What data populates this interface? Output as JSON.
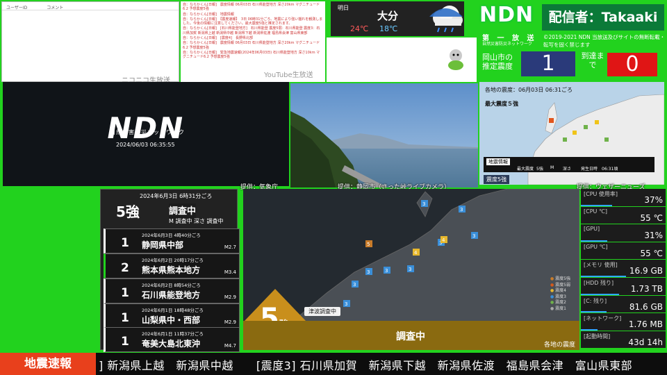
{
  "comments": {
    "col_user": "ユーザーID",
    "col_comment": "コメント",
    "service_label": "ニコニコ生放送"
  },
  "log": {
    "lines": [
      "自：ならかくん[日報]　震度情報 06月03日 石川県能登地方 深さ20km マグニチュード6.2 予想震度5強",
      "自：ならかくん[日報]　地震情報",
      "自：ならかくん[日報]　【震度速報】　3日 06時31分ごろ、地震により強い揺れを観測しました。今後の情報に注意してください。最大震度5強と推定されます。",
      "自：ならかくん[日報]　[石川県能登地方]　石川県能登 震度5弱：石川県能登 震度3：石川県加賀 新潟県上越 新潟県中越 新潟県下越 新潟県佐渡 福島県会津 富山県東部",
      "自：ならかくん[日報]　[震度4]　長野県北部",
      "自：ならかくん[日報]　震度情報 06月03日 石川県能登地方 深さ20km マグニチュード6.2 予想震度5強",
      "自：ならかくん[日報]　緊急地震速報(2024年06月03日) 石川県能登地方 深さ10km マグニチュード6.2 予想震度5強"
    ],
    "service_label": "YouTube生放送"
  },
  "weather": {
    "day": "明日",
    "city": "大分",
    "high": "24℃",
    "low": "18℃",
    "icon": "cloud-rain-icon"
  },
  "ndn": {
    "logo": "NDN",
    "caster": "配信者：Takaaki",
    "sub1": "第 一 放 送",
    "sub2": "自然災害防災ネットワーク",
    "copyright": "©2019-2021 NDN 当放送及びサイトの無断転載・転写を固く禁じます",
    "estimate_label": "岡山市の推定震度",
    "estimate_value": "1",
    "arrival_label": "到達まで",
    "arrival_value": "0"
  },
  "nico_video": {
    "logo": "NDN",
    "subtitle": "自然災害防災ネットワーク",
    "datetime": "2024/06/03 06:35:55"
  },
  "credits": {
    "jma": "提供：気象庁",
    "camera": "提供：静岡市（さった峠ライブカメラ）",
    "weathernews": "提供：ウェザーニューズ"
  },
  "shindo_map": {
    "title": "各地の震度：06月03日 06:31ごろ",
    "max": "最大震度５強",
    "info_label": "地震情報",
    "info_max": "最大震度",
    "info_max_val": "5強",
    "info_m": "M",
    "info_depth": "深さ",
    "info_time": "発生日時",
    "info_time_val": "06:31頃",
    "footer": "震度5強"
  },
  "latest_quake": {
    "date": "2024年6月3日 6時31分ごろ",
    "intensity": "5強",
    "status": "調査中",
    "meta": "M 調査中 深さ 調査中"
  },
  "history": [
    {
      "date": "2024年6月3日 4時40分ごろ",
      "intensity": "1",
      "place": "静岡県中部",
      "mag": "M2.7",
      "color": "#ffffff"
    },
    {
      "date": "2024年6月2日 20時17分ごろ",
      "intensity": "2",
      "place": "熊本県熊本地方",
      "mag": "M3.4",
      "color": "#22d21e"
    },
    {
      "date": "2024年6月2日 8時54分ごろ",
      "intensity": "1",
      "place": "石川県能登地方",
      "mag": "M2.9",
      "color": "#ffffff"
    },
    {
      "date": "2024年6月1日 18時48分ごろ",
      "intensity": "1",
      "place": "山梨県中・西部",
      "mag": "M2.9",
      "color": "#ffffff"
    },
    {
      "date": "2024年6月1日 11時37分ごろ",
      "intensity": "1",
      "place": "奄美大島北東沖",
      "mag": "M4.7",
      "color": "#ffffff"
    }
  ],
  "main_map": {
    "intensity": "5",
    "intensity_suffix": "強",
    "tsunami": "津波調査中",
    "status": "調査中",
    "caption": "各地の震度",
    "legend": [
      "震度5強",
      "震度5弱",
      "震度4",
      "震度3",
      "震度2",
      "震度1"
    ]
  },
  "stats": [
    {
      "label": "[CPU 使用率]",
      "value": "37%",
      "bar": 0.37
    },
    {
      "label": "[CPU ℃]",
      "value": "55 ℃",
      "bar": 0
    },
    {
      "label": "[GPU]",
      "value": "31%",
      "bar": 0.31
    },
    {
      "label": "[GPU ℃]",
      "value": "55 ℃",
      "bar": 0
    },
    {
      "label": "[メモリ 使用]",
      "value": "16.9 GB",
      "bar": 0.53
    },
    {
      "label": "[HDD 残り]",
      "value": "1.73 TB",
      "bar": 0.45
    },
    {
      "label": "[C: 残り]",
      "value": "81.6 GB",
      "bar": 0.3
    },
    {
      "label": "[ネットワーク]",
      "value": "1.76 MB",
      "bar": 0.2
    },
    {
      "label": "[起動時間]",
      "value": "43d 14h",
      "bar": 0
    }
  ],
  "ticker": {
    "label": "地震速報",
    "text": "] 新潟県上越　新潟県中越　　[震度3] 石川県加賀　新潟県下越　新潟県佐渡　福島県会津　富山県東部"
  }
}
